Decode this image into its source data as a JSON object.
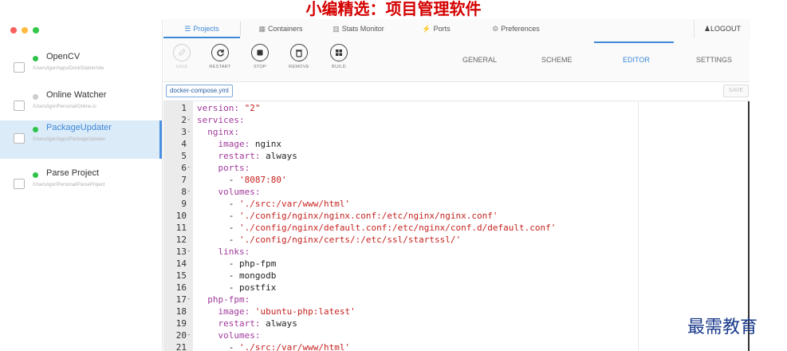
{
  "banner": "小编精选：项目管理软件",
  "watermark": "最需教育",
  "window": {
    "traffic_lights": [
      "#fc605c",
      "#fdbc40",
      "#34c84a"
    ]
  },
  "projects": [
    {
      "name": "OpenCV",
      "path": "/Users/igor/Apps/DockStation/site",
      "status_color": "#2ec44a",
      "active": false
    },
    {
      "name": "Online Watcher",
      "path": "/Users/igor/Personal/Online.io",
      "status_color": "#cccccc",
      "active": false
    },
    {
      "name": "PackageUpdater",
      "path": "/Users/igor/Apps/PackageUpdater",
      "status_color": "#2ec44a",
      "active": true
    },
    {
      "name": "Parse Project",
      "path": "/Users/igor/Personal/ParseProject",
      "status_color": "#2ec44a",
      "active": false
    }
  ],
  "nav": {
    "tabs": [
      {
        "label": "Projects",
        "icon": "list-icon",
        "glyph": "☰"
      },
      {
        "label": "Containers",
        "icon": "grid-icon",
        "glyph": "▦"
      },
      {
        "label": "Stats Monitor",
        "icon": "chart-icon",
        "glyph": "▥"
      },
      {
        "label": "Ports",
        "icon": "plug-icon",
        "glyph": "⚡"
      },
      {
        "label": "Preferences",
        "icon": "gears-icon",
        "glyph": "⚙"
      }
    ],
    "logout": "LOGOUT",
    "logout_glyph": "♟"
  },
  "toolbar": {
    "actions": [
      {
        "label": "SAVE",
        "icon": "edit-icon",
        "enabled": false
      },
      {
        "label": "RESTART",
        "icon": "refresh-icon",
        "enabled": true
      },
      {
        "label": "STOP",
        "icon": "stop-icon",
        "enabled": true
      },
      {
        "label": "REMOVE",
        "icon": "trash-icon",
        "enabled": true
      },
      {
        "label": "BUILD",
        "icon": "build-icon",
        "enabled": true
      }
    ],
    "tabs": [
      "GENERAL",
      "SCHEME",
      "EDITOR",
      "SETTINGS"
    ],
    "active_tab": "EDITOR"
  },
  "file": {
    "name": "docker-compose.yml",
    "save_label": "SAVE"
  },
  "editor": {
    "lines": [
      {
        "n": "1",
        "fold": "",
        "parts": [
          [
            "k",
            "version: "
          ],
          [
            "s",
            "\"2\""
          ]
        ]
      },
      {
        "n": "2",
        "fold": "-",
        "parts": [
          [
            "k",
            "services:"
          ]
        ]
      },
      {
        "n": "3",
        "fold": "-",
        "parts": [
          [
            "p",
            "  "
          ],
          [
            "k",
            "nginx:"
          ]
        ]
      },
      {
        "n": "4",
        "fold": "",
        "parts": [
          [
            "p",
            "    "
          ],
          [
            "k",
            "image: "
          ],
          [
            "p",
            "nginx"
          ]
        ]
      },
      {
        "n": "5",
        "fold": "",
        "parts": [
          [
            "p",
            "    "
          ],
          [
            "k",
            "restart: "
          ],
          [
            "p",
            "always"
          ]
        ]
      },
      {
        "n": "6",
        "fold": "-",
        "parts": [
          [
            "p",
            "    "
          ],
          [
            "k",
            "ports:"
          ]
        ]
      },
      {
        "n": "7",
        "fold": "",
        "parts": [
          [
            "p",
            "      - "
          ],
          [
            "s",
            "'8087:80'"
          ]
        ]
      },
      {
        "n": "8",
        "fold": "-",
        "parts": [
          [
            "p",
            "    "
          ],
          [
            "k",
            "volumes:"
          ]
        ]
      },
      {
        "n": "9",
        "fold": "",
        "parts": [
          [
            "p",
            "      - "
          ],
          [
            "s",
            "'./src:/var/www/html'"
          ]
        ]
      },
      {
        "n": "10",
        "fold": "",
        "parts": [
          [
            "p",
            "      - "
          ],
          [
            "s",
            "'./config/nginx/nginx.conf:/etc/nginx/nginx.conf'"
          ]
        ]
      },
      {
        "n": "11",
        "fold": "",
        "parts": [
          [
            "p",
            "      - "
          ],
          [
            "s",
            "'./config/nginx/default.conf:/etc/nginx/conf.d/default.conf'"
          ]
        ]
      },
      {
        "n": "12",
        "fold": "",
        "parts": [
          [
            "p",
            "      - "
          ],
          [
            "s",
            "'./config/nginx/certs/:/etc/ssl/startssl/'"
          ]
        ]
      },
      {
        "n": "13",
        "fold": "-",
        "parts": [
          [
            "p",
            "    "
          ],
          [
            "k",
            "links:"
          ]
        ]
      },
      {
        "n": "14",
        "fold": "",
        "parts": [
          [
            "p",
            "      - php-fpm"
          ]
        ]
      },
      {
        "n": "15",
        "fold": "",
        "parts": [
          [
            "p",
            "      - mongodb"
          ]
        ]
      },
      {
        "n": "16",
        "fold": "",
        "parts": [
          [
            "p",
            "      - postfix"
          ]
        ]
      },
      {
        "n": "17",
        "fold": "-",
        "parts": [
          [
            "p",
            "  "
          ],
          [
            "k",
            "php-fpm:"
          ]
        ]
      },
      {
        "n": "18",
        "fold": "",
        "parts": [
          [
            "p",
            "    "
          ],
          [
            "k",
            "image: "
          ],
          [
            "s",
            "'ubuntu-php:latest'"
          ]
        ]
      },
      {
        "n": "19",
        "fold": "",
        "parts": [
          [
            "p",
            "    "
          ],
          [
            "k",
            "restart: "
          ],
          [
            "p",
            "always"
          ]
        ]
      },
      {
        "n": "20",
        "fold": "-",
        "parts": [
          [
            "p",
            "    "
          ],
          [
            "k",
            "volumes:"
          ]
        ]
      },
      {
        "n": "21",
        "fold": "",
        "parts": [
          [
            "p",
            "      - "
          ],
          [
            "s",
            "'./src:/var/www/html'"
          ]
        ]
      }
    ]
  }
}
